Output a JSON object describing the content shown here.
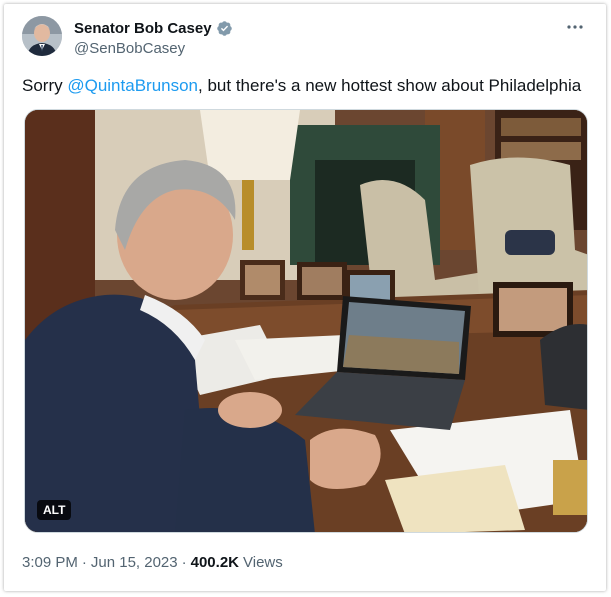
{
  "author": {
    "display_name": "Senator Bob Casey",
    "handle": "@SenBobCasey",
    "avatar_icon": "user-avatar",
    "verified_icon": "verified-badge-icon",
    "verified_color": "#829aab"
  },
  "tweet": {
    "text_before": "Sorry ",
    "mention": "@QuintaBrunson",
    "text_after": ", but there's a new hottest show about Philadelphia",
    "mention_color": "#1d9bf0"
  },
  "media": {
    "alt_label": "ALT"
  },
  "meta": {
    "time": "3:09 PM",
    "separator1": "·",
    "date": "Jun 15, 2023",
    "separator2": "·",
    "views_count": "400.2K",
    "views_label": "Views"
  },
  "more_icon": "more-options-icon"
}
